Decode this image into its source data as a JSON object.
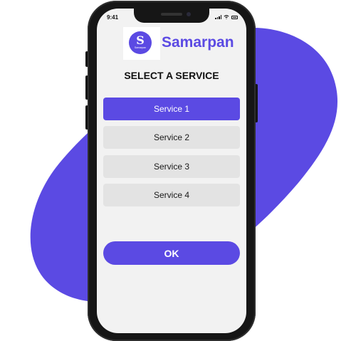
{
  "status_bar": {
    "time": "9:41"
  },
  "brand": {
    "logo_letter": "S",
    "logo_small_text": "Samarpan",
    "name": "Samarpan"
  },
  "screen_title": "SELECT A SERVICE",
  "services": [
    {
      "label": "Service 1",
      "selected": true
    },
    {
      "label": "Service 2",
      "selected": false
    },
    {
      "label": "Service 3",
      "selected": false
    },
    {
      "label": "Service 4",
      "selected": false
    }
  ],
  "ok_button": {
    "label": "OK"
  },
  "colors": {
    "accent": "#5b4ae3",
    "option_background": "#e3e3e3",
    "screen_background": "#f2f2f2",
    "phone_frame": "#161616"
  },
  "icons": [
    "signal-icon",
    "wifi-icon",
    "battery-icon"
  ]
}
